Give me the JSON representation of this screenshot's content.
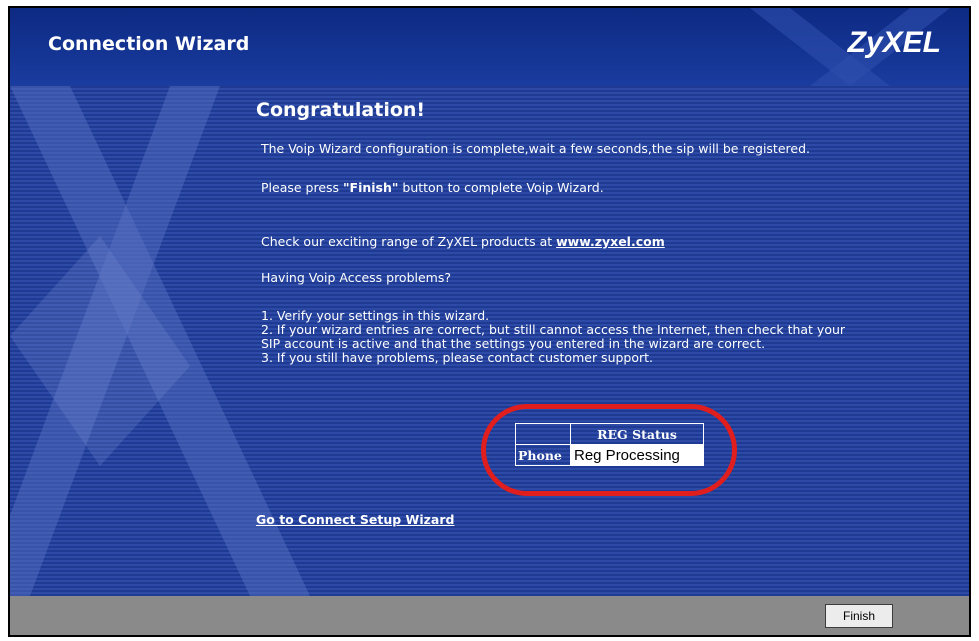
{
  "header": {
    "title": "Connection Wizard",
    "logo_text": "ZyXEL",
    "background_color": "#12318f"
  },
  "main": {
    "heading": "Congratulation!",
    "line1": "The Voip Wizard configuration is complete,wait a few seconds,the sip will be registered.",
    "line2_prefix": "Please press ",
    "line2_bold": "\"Finish\"",
    "line2_suffix": " button to complete Voip Wizard.",
    "line3_prefix": "Check our exciting range of ZyXEL products at ",
    "line3_link": "www.zyxel.com",
    "line4": "Having Voip Access problems?",
    "steps": [
      "1. Verify your settings in this wizard.",
      "2. If your wizard entries are correct, but still cannot access the Internet, then check that your",
      "SIP account is active and that the settings you entered in the wizard are correct.",
      "3. If you still have problems, please contact customer support."
    ],
    "reg_table": {
      "column_header": "REG Status",
      "row_label": "Phone",
      "row_value": "Reg Processing"
    },
    "highlight_color": "#e01e1e",
    "connect_link": "Go to Connect Setup Wizard"
  },
  "footer": {
    "finish_label": "Finish"
  }
}
